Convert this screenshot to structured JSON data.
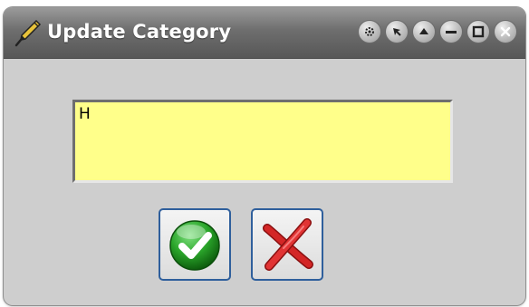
{
  "window": {
    "title": "Update Category"
  },
  "titlebar_buttons": [
    {
      "name": "settings-icon"
    },
    {
      "name": "pin-icon"
    },
    {
      "name": "roll-up-icon"
    },
    {
      "name": "minimize-icon"
    },
    {
      "name": "maximize-icon"
    },
    {
      "name": "close-icon"
    }
  ],
  "editor": {
    "value": "H"
  },
  "buttons": {
    "ok_icon": "green-checkmark-icon",
    "cancel_icon": "red-x-icon"
  },
  "colors": {
    "field_background": "#ffff8a",
    "button_border": "#2f5f9c",
    "ok_green": "#2aa52a",
    "cancel_red": "#cc2222",
    "window_background": "#cecece"
  }
}
